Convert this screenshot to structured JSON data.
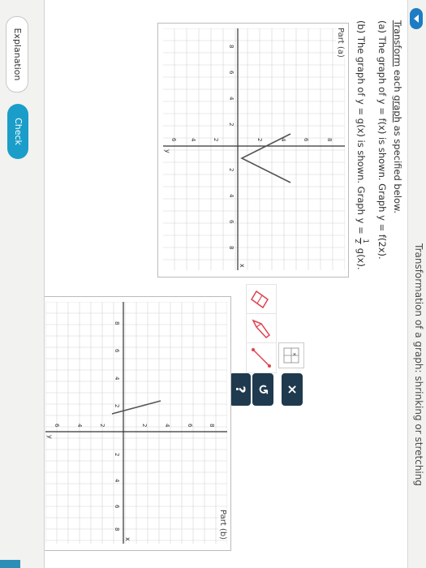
{
  "header": {
    "title": "Transformation of a graph: shrinking or stretching"
  },
  "instructions": {
    "line1_link1": "Transform",
    "line1_mid": " each ",
    "line1_link2": "graph",
    "line1_end": " as specified below.",
    "part_a_text": "(a) The graph of y = f(x) is shown. Graph y = f(2x).",
    "part_b_start": "(b) The graph of y = g(x) is shown. Graph y =",
    "part_b_num": "1",
    "part_b_den": "2",
    "part_b_end": "g(x)."
  },
  "graph_a": {
    "label": "Part (a)",
    "y_ticks": [
      "8",
      "6",
      "4",
      "2",
      "2",
      "4",
      "6",
      "8"
    ],
    "x_ticks": [
      "8",
      "6",
      "4",
      "2",
      "2",
      "4",
      "6",
      "8"
    ],
    "axis_x": "x",
    "axis_y": "y"
  },
  "graph_b": {
    "label": "Part (b)",
    "y_ticks": [
      "8",
      "6",
      "4",
      "2",
      "2",
      "4",
      "6",
      "8"
    ],
    "x_ticks": [
      "8",
      "6",
      "4",
      "2",
      "2",
      "4",
      "6",
      "8"
    ],
    "axis_x": "x",
    "axis_y": "y"
  },
  "toolbar": {
    "clear_symbol": "×",
    "undo_symbol": "↺",
    "help_symbol": "?",
    "tool_icons": [
      "graph-paper-icon",
      "eraser-icon",
      "pencil-icon",
      "line-tool-icon"
    ]
  },
  "footer": {
    "explanation_label": "Explanation",
    "check_label": "Check"
  },
  "colors": {
    "accent": "#1a9ec9",
    "dark_button": "#1f3a4e",
    "curve": "#444444",
    "tool_red": "#e0414f"
  }
}
